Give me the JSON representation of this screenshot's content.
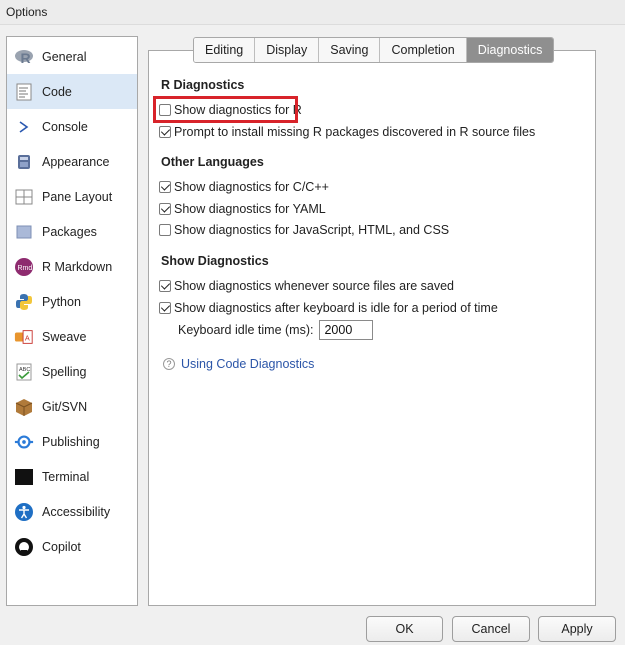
{
  "window": {
    "title": "Options"
  },
  "sidebar": {
    "items": [
      {
        "label": "General",
        "icon": "r-logo-icon"
      },
      {
        "label": "Code",
        "icon": "code-icon",
        "selected": true
      },
      {
        "label": "Console",
        "icon": "console-icon"
      },
      {
        "label": "Appearance",
        "icon": "appearance-icon"
      },
      {
        "label": "Pane Layout",
        "icon": "pane-layout-icon"
      },
      {
        "label": "Packages",
        "icon": "packages-icon"
      },
      {
        "label": "R Markdown",
        "icon": "rmarkdown-icon"
      },
      {
        "label": "Python",
        "icon": "python-icon"
      },
      {
        "label": "Sweave",
        "icon": "sweave-icon"
      },
      {
        "label": "Spelling",
        "icon": "spelling-icon"
      },
      {
        "label": "Git/SVN",
        "icon": "git-icon"
      },
      {
        "label": "Publishing",
        "icon": "publishing-icon"
      },
      {
        "label": "Terminal",
        "icon": "terminal-icon"
      },
      {
        "label": "Accessibility",
        "icon": "accessibility-icon"
      },
      {
        "label": "Copilot",
        "icon": "copilot-icon"
      }
    ]
  },
  "tabs": {
    "items": [
      {
        "label": "Editing"
      },
      {
        "label": "Display"
      },
      {
        "label": "Saving"
      },
      {
        "label": "Completion"
      },
      {
        "label": "Diagnostics",
        "active": true
      }
    ]
  },
  "sections": {
    "r_diagnostics": {
      "title": "R Diagnostics",
      "show_r": {
        "label": "Show diagnostics for R",
        "checked": false
      },
      "prompt_install": {
        "label": "Prompt to install missing R packages discovered in R source files",
        "checked": true
      }
    },
    "other_languages": {
      "title": "Other Languages",
      "cpp": {
        "label": "Show diagnostics for C/C++",
        "checked": true
      },
      "yaml": {
        "label": "Show diagnostics for YAML",
        "checked": true
      },
      "web": {
        "label": "Show diagnostics for JavaScript, HTML, and CSS",
        "checked": false
      }
    },
    "show_diagnostics": {
      "title": "Show Diagnostics",
      "on_save": {
        "label": "Show diagnostics whenever source files are saved",
        "checked": true
      },
      "on_idle": {
        "label": "Show diagnostics after keyboard is idle for a period of time",
        "checked": true
      },
      "idle_time": {
        "label": "Keyboard idle time (ms):",
        "value": "2000"
      }
    },
    "help": {
      "link": "Using Code Diagnostics",
      "icon_glyph": "?"
    }
  },
  "buttons": {
    "ok": "OK",
    "cancel": "Cancel",
    "apply": "Apply"
  },
  "colors": {
    "highlight": "#d8232a",
    "selected_bg": "#dbe8f6",
    "active_tab": "#8f8f8f",
    "link": "#2b55a8"
  }
}
